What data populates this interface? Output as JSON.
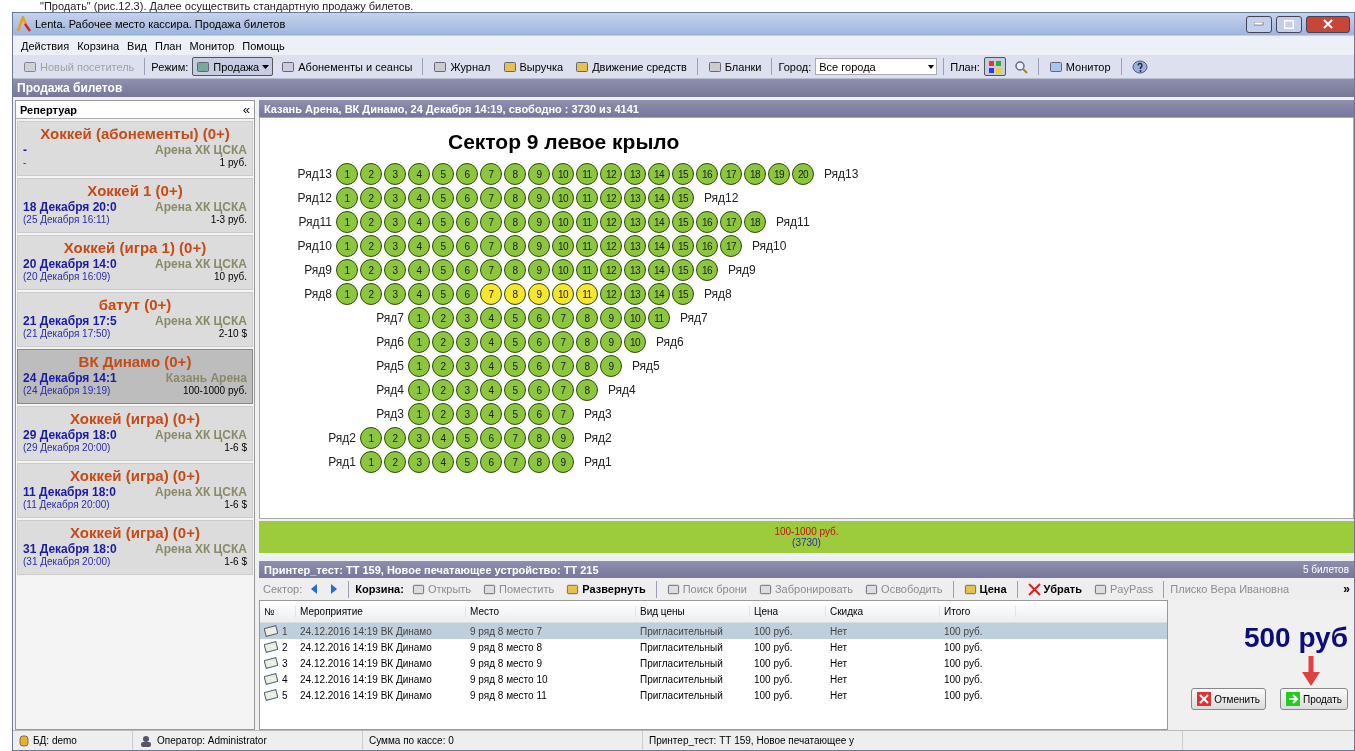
{
  "doc_caption": "\"Продать\" (рис.12.3). Далее осуществить стандартную продажу билетов.",
  "window": {
    "title": "Lenta. Рабочее место кассира. Продажа билетов"
  },
  "menu": [
    "Действия",
    "Корзина",
    "Вид",
    "План",
    "Монитор",
    "Помощь"
  ],
  "toolbar": [
    {
      "kind": "button",
      "label": "Новый посетитель",
      "disabled": true,
      "pressed": false
    },
    {
      "kind": "separator"
    },
    {
      "kind": "label",
      "label": "Режим:"
    },
    {
      "kind": "button",
      "label": "Продажа",
      "disabled": false,
      "pressed": true,
      "dropdown": true
    },
    {
      "kind": "button",
      "label": "Абонементы и сеансы",
      "disabled": false,
      "pressed": false
    },
    {
      "kind": "separator"
    },
    {
      "kind": "button",
      "label": "Журнал",
      "disabled": false,
      "pressed": false
    },
    {
      "kind": "button",
      "label": "Выручка",
      "disabled": false,
      "pressed": false
    },
    {
      "kind": "button",
      "label": "Движение средств",
      "disabled": false,
      "pressed": false
    },
    {
      "kind": "separator"
    },
    {
      "kind": "button",
      "label": "Бланки",
      "disabled": false,
      "pressed": false
    },
    {
      "kind": "separator"
    },
    {
      "kind": "label",
      "label": "Город:"
    },
    {
      "kind": "select",
      "value": "Все города"
    },
    {
      "kind": "separator"
    },
    {
      "kind": "label",
      "label": "План:"
    },
    {
      "kind": "icon",
      "pressed": true
    },
    {
      "kind": "icon",
      "pressed": false
    },
    {
      "kind": "separator"
    },
    {
      "kind": "button",
      "label": "Монитор",
      "disabled": false,
      "pressed": false
    },
    {
      "kind": "separator"
    },
    {
      "kind": "icon",
      "pressed": false
    }
  ],
  "section_title": "Продажа билетов",
  "sidebar": {
    "title": "Репертуар",
    "collapse": "«",
    "items": [
      {
        "title": "Хоккей (абонементы) (0+)",
        "date": "-",
        "venue": "Арена ХК ЦСКА",
        "subdate": "-",
        "price": "1 руб.",
        "selected": false
      },
      {
        "title": "Хоккей 1 (0+)",
        "date": "18 Декабря 20:0",
        "venue": "Арена ХК ЦСКА",
        "subdate": "(25 Декабря 16:11)",
        "price": "1-3 руб.",
        "selected": false
      },
      {
        "title": "Хоккей (игра 1) (0+)",
        "date": "20 Декабря 14:0",
        "venue": "Арена ХК ЦСКА",
        "subdate": "(20 Декабря 16:09)",
        "price": "10 руб.",
        "selected": false
      },
      {
        "title": "батут (0+)",
        "date": "21 Декабря 17:5",
        "venue": "Арена ХК ЦСКА",
        "subdate": "(21 Декабря 17:50)",
        "price": "2-10 $",
        "selected": false
      },
      {
        "title": "ВК Динамо (0+)",
        "date": "24 Декабря 14:1",
        "venue": "Казань Арена",
        "subdate": "(24 Декабря 19:19)",
        "price": "100-1000 руб.",
        "selected": true
      },
      {
        "title": "Хоккей (игра) (0+)",
        "date": "29 Декабря 18:0",
        "venue": "Арена ХК ЦСКА",
        "subdate": "(29 Декабря 20:00)",
        "price": "1-6 $",
        "selected": false
      },
      {
        "title": "Хоккей (игра) (0+)",
        "date": "11 Декабря 18:0",
        "venue": "Арена ХК ЦСКА",
        "subdate": "(11 Декабря 20:00)",
        "price": "1-6 $",
        "selected": false
      },
      {
        "title": "Хоккей (игра) (0+)",
        "date": "31 Декабря 18:0",
        "venue": "Арена ХК ЦСКА",
        "subdate": "(31 Декабря 20:00)",
        "price": "1-6 $",
        "selected": false
      }
    ]
  },
  "event_header": "Казань Арена, ВК Динамо, 24 Декабря 14:19, свободно : 3730 из 4141",
  "plan": {
    "title": "Сектор 9 левое крыло",
    "rows": [
      {
        "left": "Ряд13",
        "right": "Ряд13",
        "spaces": [],
        "seats": [
          {
            "n": "1",
            "selected": false
          },
          {
            "n": "2",
            "selected": false
          },
          {
            "n": "3",
            "selected": false
          },
          {
            "n": "4",
            "selected": false
          },
          {
            "n": "5",
            "selected": false
          },
          {
            "n": "6",
            "selected": false
          },
          {
            "n": "7",
            "selected": false
          },
          {
            "n": "8",
            "selected": false
          },
          {
            "n": "9",
            "selected": false
          },
          {
            "n": "10",
            "selected": false
          },
          {
            "n": "11",
            "selected": false
          },
          {
            "n": "12",
            "selected": false
          },
          {
            "n": "13",
            "selected": false
          },
          {
            "n": "14",
            "selected": false
          },
          {
            "n": "15",
            "selected": false
          },
          {
            "n": "16",
            "selected": false
          },
          {
            "n": "17",
            "selected": false
          },
          {
            "n": "18",
            "selected": false
          },
          {
            "n": "19",
            "selected": false
          },
          {
            "n": "20",
            "selected": false
          }
        ]
      },
      {
        "left": "Ряд12",
        "right": "Ряд12",
        "spaces": [],
        "seats": [
          {
            "n": "1",
            "selected": false
          },
          {
            "n": "2",
            "selected": false
          },
          {
            "n": "3",
            "selected": false
          },
          {
            "n": "4",
            "selected": false
          },
          {
            "n": "5",
            "selected": false
          },
          {
            "n": "6",
            "selected": false
          },
          {
            "n": "7",
            "selected": false
          },
          {
            "n": "8",
            "selected": false
          },
          {
            "n": "9",
            "selected": false
          },
          {
            "n": "10",
            "selected": false
          },
          {
            "n": "11",
            "selected": false
          },
          {
            "n": "12",
            "selected": false
          },
          {
            "n": "13",
            "selected": false
          },
          {
            "n": "14",
            "selected": false
          },
          {
            "n": "15",
            "selected": false
          }
        ]
      },
      {
        "left": "Ряд11",
        "right": "Ряд11",
        "spaces": [],
        "seats": [
          {
            "n": "1",
            "selected": false
          },
          {
            "n": "2",
            "selected": false
          },
          {
            "n": "3",
            "selected": false
          },
          {
            "n": "4",
            "selected": false
          },
          {
            "n": "5",
            "selected": false
          },
          {
            "n": "6",
            "selected": false
          },
          {
            "n": "7",
            "selected": false
          },
          {
            "n": "8",
            "selected": false
          },
          {
            "n": "9",
            "selected": false
          },
          {
            "n": "10",
            "selected": false
          },
          {
            "n": "11",
            "selected": false
          },
          {
            "n": "12",
            "selected": false
          },
          {
            "n": "13",
            "selected": false
          },
          {
            "n": "14",
            "selected": false
          },
          {
            "n": "15",
            "selected": false
          },
          {
            "n": "16",
            "selected": false
          },
          {
            "n": "17",
            "selected": false
          },
          {
            "n": "18",
            "selected": false
          }
        ]
      },
      {
        "left": "Ряд10",
        "right": "Ряд10",
        "spaces": [],
        "seats": [
          {
            "n": "1",
            "selected": false
          },
          {
            "n": "2",
            "selected": false
          },
          {
            "n": "3",
            "selected": false
          },
          {
            "n": "4",
            "selected": false
          },
          {
            "n": "5",
            "selected": false
          },
          {
            "n": "6",
            "selected": false
          },
          {
            "n": "7",
            "selected": false
          },
          {
            "n": "8",
            "selected": false
          },
          {
            "n": "9",
            "selected": false
          },
          {
            "n": "10",
            "selected": false
          },
          {
            "n": "11",
            "selected": false
          },
          {
            "n": "12",
            "selected": false
          },
          {
            "n": "13",
            "selected": false
          },
          {
            "n": "14",
            "selected": false
          },
          {
            "n": "15",
            "selected": false
          },
          {
            "n": "16",
            "selected": false
          },
          {
            "n": "17",
            "selected": false
          }
        ]
      },
      {
        "left": "Ряд9",
        "right": "Ряд9",
        "spaces": [],
        "seats": [
          {
            "n": "1",
            "selected": false
          },
          {
            "n": "2",
            "selected": false
          },
          {
            "n": "3",
            "selected": false
          },
          {
            "n": "4",
            "selected": false
          },
          {
            "n": "5",
            "selected": false
          },
          {
            "n": "6",
            "selected": false
          },
          {
            "n": "7",
            "selected": false
          },
          {
            "n": "8",
            "selected": false
          },
          {
            "n": "9",
            "selected": false
          },
          {
            "n": "10",
            "selected": false
          },
          {
            "n": "11",
            "selected": false
          },
          {
            "n": "12",
            "selected": false
          },
          {
            "n": "13",
            "selected": false
          },
          {
            "n": "14",
            "selected": false
          },
          {
            "n": "15",
            "selected": false
          },
          {
            "n": "16",
            "selected": false
          }
        ]
      },
      {
        "left": "Ряд8",
        "right": "Ряд8",
        "spaces": [],
        "seats": [
          {
            "n": "1",
            "selected": false
          },
          {
            "n": "2",
            "selected": false
          },
          {
            "n": "3",
            "selected": false
          },
          {
            "n": "4",
            "selected": false
          },
          {
            "n": "5",
            "selected": false
          },
          {
            "n": "6",
            "selected": false
          },
          {
            "n": "7",
            "selected": true
          },
          {
            "n": "8",
            "selected": true
          },
          {
            "n": "9",
            "selected": true
          },
          {
            "n": "10",
            "selected": true
          },
          {
            "n": "11",
            "selected": true
          },
          {
            "n": "12",
            "selected": false
          },
          {
            "n": "13",
            "selected": false
          },
          {
            "n": "14",
            "selected": false
          },
          {
            "n": "15",
            "selected": false
          }
        ]
      },
      {
        "left": "Ряд7",
        "right": "Ряд7",
        "spaces": [
          {
            "kind": "space"
          },
          {
            "kind": "space"
          },
          {
            "kind": "space"
          }
        ],
        "seats": [
          {
            "n": "1",
            "selected": false
          },
          {
            "n": "2",
            "selected": false
          },
          {
            "n": "3",
            "selected": false
          },
          {
            "n": "4",
            "selected": false
          },
          {
            "n": "5",
            "selected": false
          },
          {
            "n": "6",
            "selected": false
          },
          {
            "n": "7",
            "selected": false
          },
          {
            "n": "8",
            "selected": false
          },
          {
            "n": "9",
            "selected": false
          },
          {
            "n": "10",
            "selected": false
          },
          {
            "n": "11",
            "selected": false
          }
        ]
      },
      {
        "left": "Ряд6",
        "right": "Ряд6",
        "spaces": [
          {
            "kind": "space"
          },
          {
            "kind": "space"
          },
          {
            "kind": "space"
          }
        ],
        "seats": [
          {
            "n": "1",
            "selected": false
          },
          {
            "n": "2",
            "selected": false
          },
          {
            "n": "3",
            "selected": false
          },
          {
            "n": "4",
            "selected": false
          },
          {
            "n": "5",
            "selected": false
          },
          {
            "n": "6",
            "selected": false
          },
          {
            "n": "7",
            "selected": false
          },
          {
            "n": "8",
            "selected": false
          },
          {
            "n": "9",
            "selected": false
          },
          {
            "n": "10",
            "selected": false
          }
        ]
      },
      {
        "left": "Ряд5",
        "right": "Ряд5",
        "spaces": [
          {
            "kind": "space"
          },
          {
            "kind": "space"
          },
          {
            "kind": "space"
          }
        ],
        "seats": [
          {
            "n": "1",
            "selected": false
          },
          {
            "n": "2",
            "selected": false
          },
          {
            "n": "3",
            "selected": false
          },
          {
            "n": "4",
            "selected": false
          },
          {
            "n": "5",
            "selected": false
          },
          {
            "n": "6",
            "selected": false
          },
          {
            "n": "7",
            "selected": false
          },
          {
            "n": "8",
            "selected": false
          },
          {
            "n": "9",
            "selected": false
          }
        ]
      },
      {
        "left": "Ряд4",
        "right": "Ряд4",
        "spaces": [
          {
            "kind": "space"
          },
          {
            "kind": "space"
          },
          {
            "kind": "space"
          }
        ],
        "seats": [
          {
            "n": "1",
            "selected": false
          },
          {
            "n": "2",
            "selected": false
          },
          {
            "n": "3",
            "selected": false
          },
          {
            "n": "4",
            "selected": false
          },
          {
            "n": "5",
            "selected": false
          },
          {
            "n": "6",
            "selected": false
          },
          {
            "n": "7",
            "selected": false
          },
          {
            "n": "8",
            "selected": false
          }
        ]
      },
      {
        "left": "Ряд3",
        "right": "Ряд3",
        "spaces": [
          {
            "kind": "space"
          },
          {
            "kind": "space"
          },
          {
            "kind": "space"
          }
        ],
        "seats": [
          {
            "n": "1",
            "selected": false
          },
          {
            "n": "2",
            "selected": false
          },
          {
            "n": "3",
            "selected": false
          },
          {
            "n": "4",
            "selected": false
          },
          {
            "n": "5",
            "selected": false
          },
          {
            "n": "6",
            "selected": false
          },
          {
            "n": "7",
            "selected": false
          }
        ]
      },
      {
        "left": "Ряд2",
        "right": "Ряд2",
        "spaces": [
          {
            "kind": "space"
          }
        ],
        "seats": [
          {
            "n": "1",
            "selected": false
          },
          {
            "n": "2",
            "selected": false
          },
          {
            "n": "3",
            "selected": false
          },
          {
            "n": "4",
            "selected": false
          },
          {
            "n": "5",
            "selected": false
          },
          {
            "n": "6",
            "selected": false
          },
          {
            "n": "7",
            "selected": false
          },
          {
            "n": "8",
            "selected": false
          },
          {
            "n": "9",
            "selected": false
          }
        ]
      },
      {
        "left": "Ряд1",
        "right": "Ряд1",
        "spaces": [
          {
            "kind": "space"
          }
        ],
        "seats": [
          {
            "n": "1",
            "selected": false
          },
          {
            "n": "2",
            "selected": false
          },
          {
            "n": "3",
            "selected": false
          },
          {
            "n": "4",
            "selected": false
          },
          {
            "n": "5",
            "selected": false
          },
          {
            "n": "6",
            "selected": false
          },
          {
            "n": "7",
            "selected": false
          },
          {
            "n": "8",
            "selected": false
          },
          {
            "n": "9",
            "selected": false
          }
        ]
      }
    ]
  },
  "price_bar": {
    "price": "100-1000 руб.",
    "count": "(3730)"
  },
  "cart": {
    "title": "Принтер_тест: ТТ 159, Новое печатающее устройство: ТТ 215",
    "count": "5 билетов",
    "toolbar": [
      {
        "kind": "label",
        "label": "Сектор:",
        "disabled": true
      },
      {
        "kind": "icon",
        "disabled": false
      },
      {
        "kind": "icon",
        "disabled": false
      },
      {
        "kind": "separator"
      },
      {
        "kind": "label",
        "label": "Корзина:",
        "disabled": false
      },
      {
        "kind": "button",
        "label": "Открыть",
        "disabled": true
      },
      {
        "kind": "button",
        "label": "Поместить",
        "disabled": true
      },
      {
        "kind": "button",
        "label": "Развернуть",
        "disabled": false
      },
      {
        "kind": "separator"
      },
      {
        "kind": "button",
        "label": "Поиск брони",
        "disabled": true
      },
      {
        "kind": "button",
        "label": "Забронировать",
        "disabled": true
      },
      {
        "kind": "button",
        "label": "Освободить",
        "disabled": true
      },
      {
        "kind": "separator"
      },
      {
        "kind": "button",
        "label": "Цена",
        "disabled": false
      },
      {
        "kind": "separator"
      },
      {
        "kind": "button",
        "label": "Убрать",
        "disabled": false
      },
      {
        "kind": "button",
        "label": "PayPass",
        "disabled": true
      },
      {
        "kind": "separator"
      },
      {
        "kind": "label",
        "label": "Плиско Вера Ивановна",
        "disabled": true
      }
    ],
    "overflow": "»",
    "columns": [
      "№",
      "Мероприятие",
      "Место",
      "Вид цены",
      "Цена",
      "Скидка",
      "Итого"
    ],
    "rows": [
      {
        "cells": [
          "1",
          "24.12.2016 14:19 ВК Динамо",
          "9 ряд 8 место 7",
          "Пригласительный",
          "100 руб.",
          "Нет",
          "100 руб."
        ],
        "selected": true
      },
      {
        "cells": [
          "2",
          "24.12.2016 14:19 ВК Динамо",
          "9 ряд 8 место 8",
          "Пригласительный",
          "100 руб.",
          "Нет",
          "100 руб."
        ],
        "selected": false
      },
      {
        "cells": [
          "3",
          "24.12.2016 14:19 ВК Динамо",
          "9 ряд 8 место 9",
          "Пригласительный",
          "100 руб.",
          "Нет",
          "100 руб."
        ],
        "selected": false
      },
      {
        "cells": [
          "4",
          "24.12.2016 14:19 ВК Динамо",
          "9 ряд 8 место 10",
          "Пригласительный",
          "100 руб.",
          "Нет",
          "100 руб."
        ],
        "selected": false
      },
      {
        "cells": [
          "5",
          "24.12.2016 14:19 ВК Динамо",
          "9 ряд 8 место 11",
          "Пригласительный",
          "100 руб.",
          "Нет",
          "100 руб."
        ],
        "selected": false
      }
    ],
    "total": "500 руб",
    "buttons": [
      {
        "kind": "cancel",
        "label": "Отменить"
      },
      {
        "kind": "sell",
        "label": "Продать"
      }
    ]
  },
  "status_bar": [
    {
      "kind": "db",
      "text": "БД: demo"
    },
    {
      "kind": "operator",
      "text": "Оператор: Administrator"
    },
    {
      "kind": "plain",
      "text": "Сумма по кассе: 0"
    },
    {
      "kind": "plain",
      "text": "Принтер_тест: ТТ 159, Новое печатающее у"
    }
  ]
}
